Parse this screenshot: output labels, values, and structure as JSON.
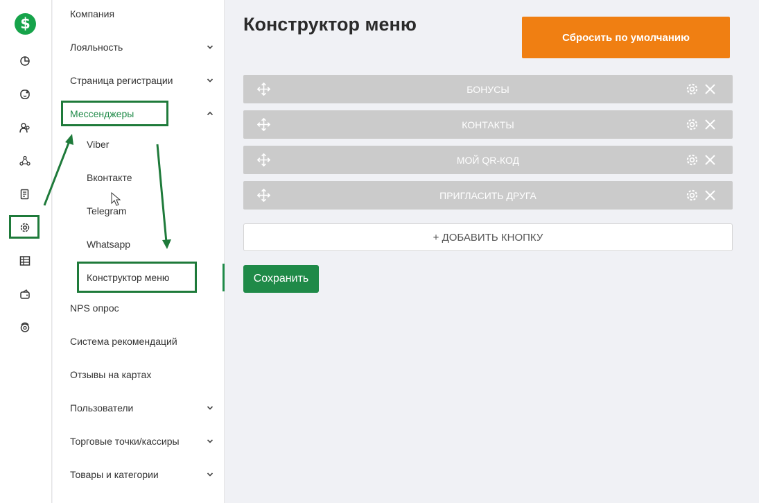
{
  "logo": {
    "glyph": "$"
  },
  "rail": {
    "icons": [
      "dashboard-icon",
      "chat-icon",
      "users-icon",
      "network-icon",
      "document-icon",
      "settings-icon",
      "table-icon",
      "wallet-icon",
      "support-icon"
    ]
  },
  "submenu": {
    "items": [
      {
        "label": "Компания"
      },
      {
        "label": "Лояльность"
      },
      {
        "label": "Страница регистрации"
      },
      {
        "label": "Мессенджеры"
      },
      {
        "label": "Viber"
      },
      {
        "label": "Вконтакте"
      },
      {
        "label": "Telegram"
      },
      {
        "label": "Whatsapp"
      },
      {
        "label": "Конструктор меню"
      },
      {
        "label": "NPS опрос"
      },
      {
        "label": "Система рекомендаций"
      },
      {
        "label": "Отзывы на картах"
      },
      {
        "label": "Пользователи"
      },
      {
        "label": "Торговые точки/кассиры"
      },
      {
        "label": "Товары и категории"
      }
    ]
  },
  "main": {
    "title": "Конструктор меню",
    "reset_label": "Сбросить по умолчанию",
    "buttons": [
      {
        "label": "БОНУСЫ"
      },
      {
        "label": "КОНТАКТЫ"
      },
      {
        "label": "МОЙ QR-КОД"
      },
      {
        "label": "ПРИГЛАСИТЬ ДРУГА"
      }
    ],
    "add_label": "+ ДОБАВИТЬ КНОПКУ",
    "save_label": "Сохранить"
  },
  "colors": {
    "accent": "#1f8a48",
    "reset": "#f07f12",
    "row": "#cbcbcb"
  }
}
